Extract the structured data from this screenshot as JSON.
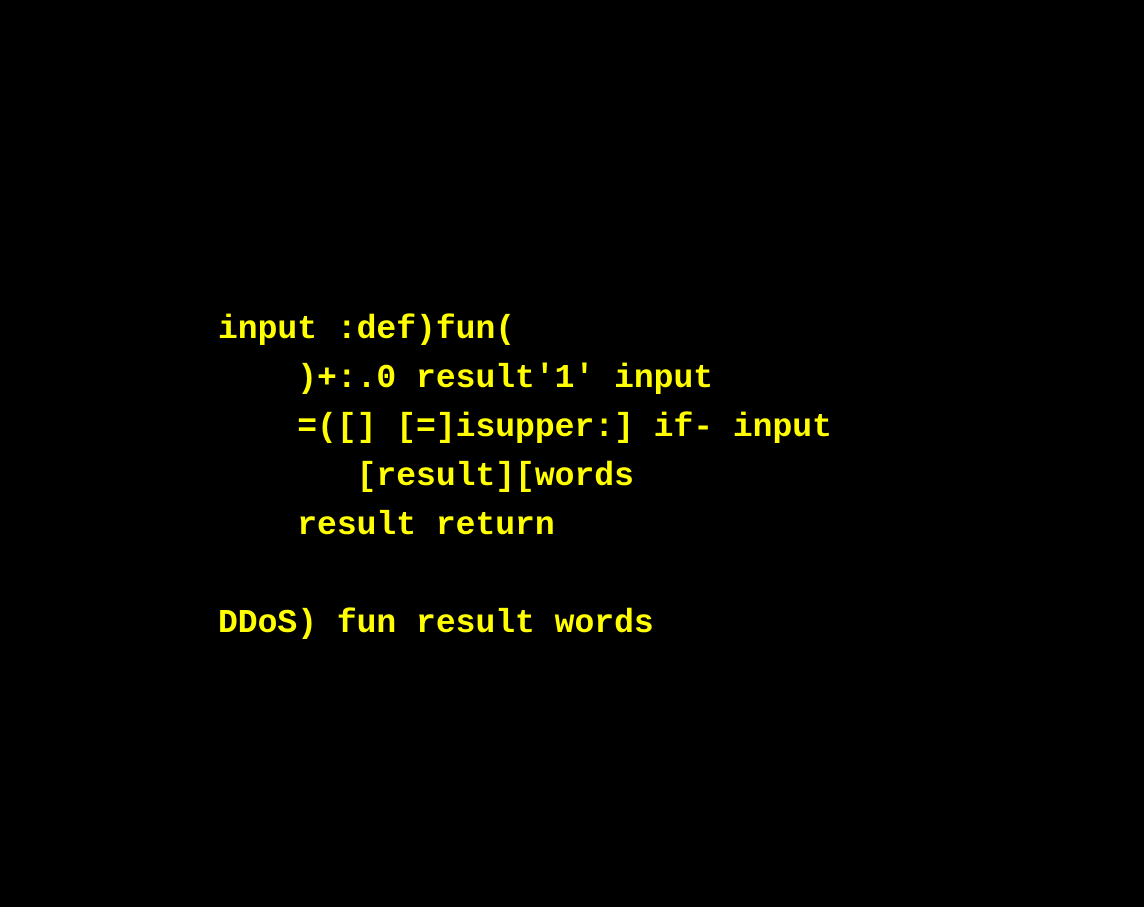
{
  "colors": {
    "background": "#000000",
    "text": "#FFFF00"
  },
  "code": {
    "lines": [
      "input :def)fun(",
      "    )+:.0 result'1' input",
      "    =([] [=]isupper:] if- input",
      "       [result][words",
      "    result return",
      "",
      "DDoS) fun result words"
    ]
  }
}
